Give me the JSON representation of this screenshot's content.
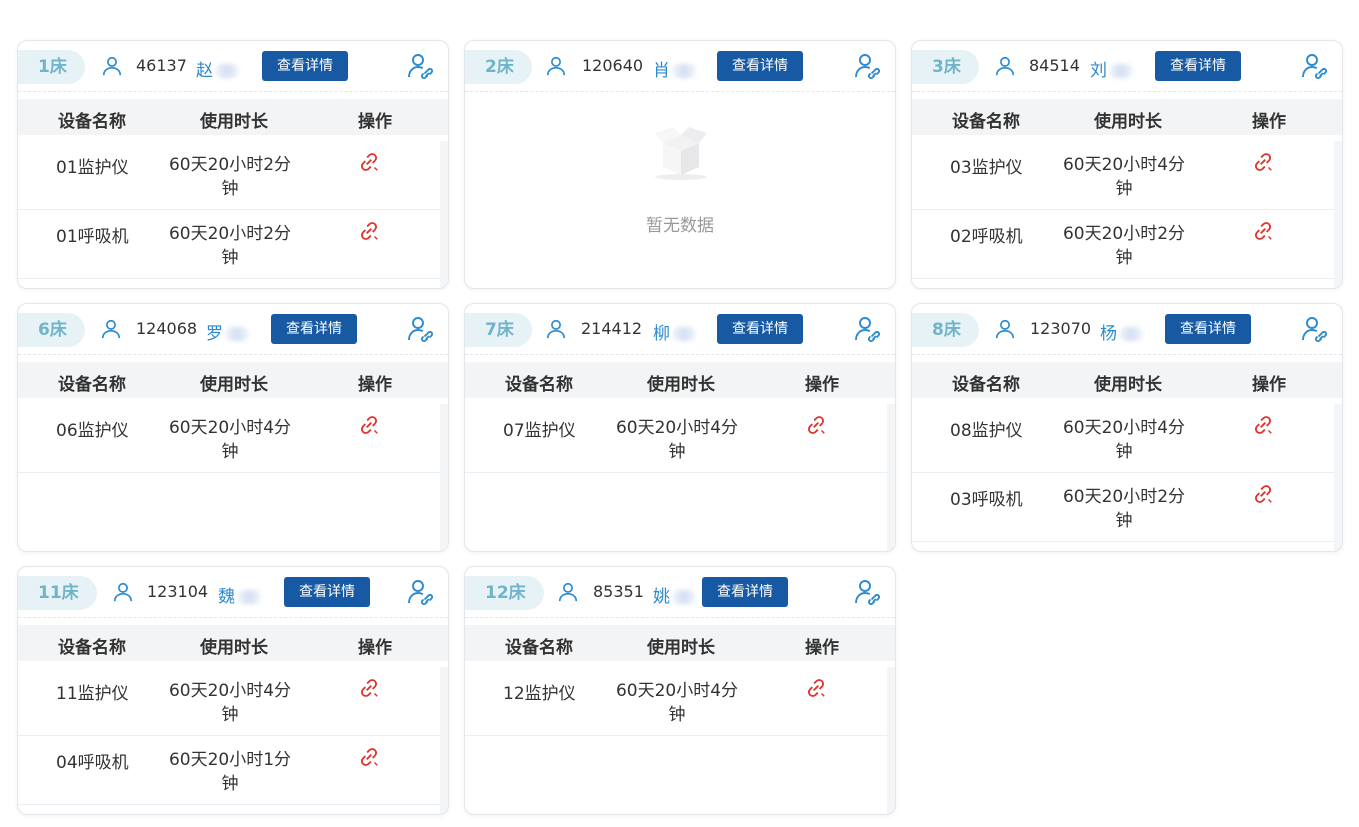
{
  "colors": {
    "accent": "#1759a3",
    "bed_bg": "#e7f2f7",
    "bed_text": "#6fb4c8",
    "name": "#2b8ad0",
    "unbind": "#e0332c"
  },
  "table_headers": {
    "device": "设备名称",
    "duration": "使用时长",
    "action": "操作"
  },
  "detail_label": "查看详情",
  "empty_text": "暂无数据",
  "cards": [
    {
      "bed": "1床",
      "pid": "46137",
      "name": "赵",
      "devices": [
        {
          "name": "01监护仪",
          "duration": "60天20小时2分钟"
        },
        {
          "name": "01呼吸机",
          "duration": "60天20小时2分钟"
        }
      ]
    },
    {
      "bed": "2床",
      "pid": "120640",
      "name": "肖",
      "devices": []
    },
    {
      "bed": "3床",
      "pid": "84514",
      "name": "刘",
      "devices": [
        {
          "name": "03监护仪",
          "duration": "60天20小时4分钟"
        },
        {
          "name": "02呼吸机",
          "duration": "60天20小时2分钟"
        }
      ]
    },
    {
      "bed": "6床",
      "pid": "124068",
      "name": "罗",
      "devices": [
        {
          "name": "06监护仪",
          "duration": "60天20小时4分钟"
        }
      ]
    },
    {
      "bed": "7床",
      "pid": "214412",
      "name": "柳",
      "devices": [
        {
          "name": "07监护仪",
          "duration": "60天20小时4分钟"
        }
      ]
    },
    {
      "bed": "8床",
      "pid": "123070",
      "name": "杨",
      "devices": [
        {
          "name": "08监护仪",
          "duration": "60天20小时4分钟"
        },
        {
          "name": "03呼吸机",
          "duration": "60天20小时2分钟"
        }
      ]
    },
    {
      "bed": "11床",
      "pid": "123104",
      "name": "魏",
      "devices": [
        {
          "name": "11监护仪",
          "duration": "60天20小时4分钟"
        },
        {
          "name": "04呼吸机",
          "duration": "60天20小时1分钟"
        }
      ]
    },
    {
      "bed": "12床",
      "pid": "85351",
      "name": "姚",
      "devices": [
        {
          "name": "12监护仪",
          "duration": "60天20小时4分钟"
        }
      ]
    }
  ]
}
